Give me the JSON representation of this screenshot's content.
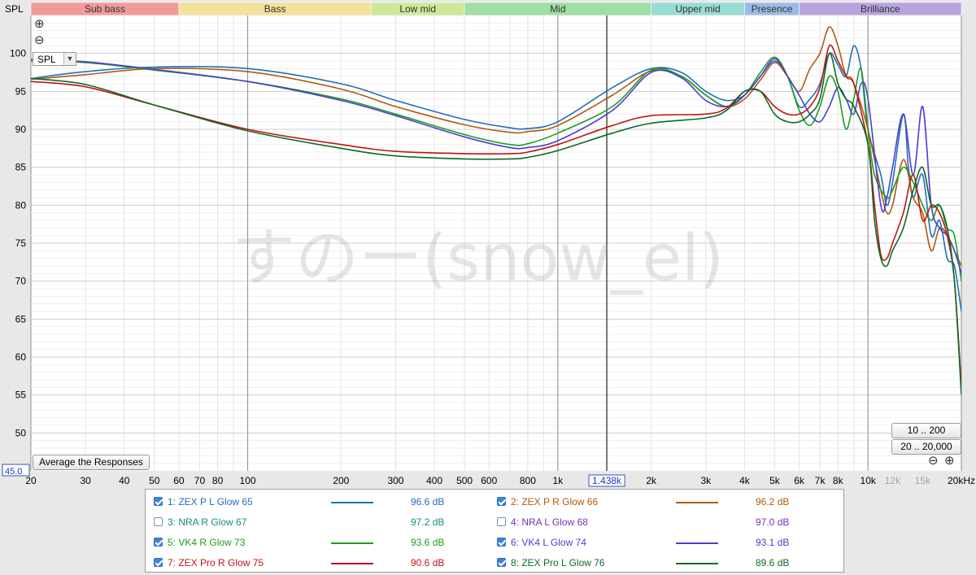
{
  "colors": {
    "zex_p_l": "#1f6fbf",
    "zex_p_r": "#b35a0a",
    "nra_r": "#1a8a82",
    "nra_l": "#7a2fb8",
    "vk4_r": "#1f9d1f",
    "vk4_l": "#4b3fd0",
    "zex_pro_r": "#c01414",
    "zex_pro_l": "#0a6a2a"
  },
  "chart_data": {
    "type": "line",
    "ylabel": "SPL",
    "xunit": "Hz",
    "xscale": "log",
    "xlim": [
      20,
      20000
    ],
    "ylim": [
      45,
      105
    ],
    "yticks": [
      50,
      55,
      60,
      65,
      70,
      75,
      80,
      85,
      90,
      95,
      100
    ],
    "xticks": [
      {
        "v": 20,
        "t": "20"
      },
      {
        "v": 30,
        "t": "30"
      },
      {
        "v": 40,
        "t": "40"
      },
      {
        "v": 50,
        "t": "50"
      },
      {
        "v": 60,
        "t": "60"
      },
      {
        "v": 70,
        "t": "70"
      },
      {
        "v": 80,
        "t": "80"
      },
      {
        "v": 100,
        "t": "100"
      },
      {
        "v": 200,
        "t": "200"
      },
      {
        "v": 300,
        "t": "300"
      },
      {
        "v": 400,
        "t": "400"
      },
      {
        "v": 500,
        "t": "500"
      },
      {
        "v": 600,
        "t": "600"
      },
      {
        "v": 800,
        "t": "800"
      },
      {
        "v": 1000,
        "t": "1k"
      },
      {
        "v": 2000,
        "t": "2k"
      },
      {
        "v": 3000,
        "t": "3k"
      },
      {
        "v": 4000,
        "t": "4k"
      },
      {
        "v": 5000,
        "t": "5k"
      },
      {
        "v": 6000,
        "t": "6k"
      },
      {
        "v": 7000,
        "t": "7k"
      },
      {
        "v": 8000,
        "t": "8k"
      },
      {
        "v": 10000,
        "t": "10k"
      },
      {
        "v": 12000,
        "t": "12k",
        "grey": true
      },
      {
        "v": 15000,
        "t": "15k",
        "grey": true
      },
      {
        "v": 20000,
        "t": "20kHz"
      }
    ],
    "ymin_label": "45.0",
    "cursor": {
      "x": 1438,
      "label": "1.438k"
    },
    "bands": [
      {
        "name": "Sub bass",
        "from": 20,
        "to": 60,
        "color": "#f29a9a"
      },
      {
        "name": "Bass",
        "from": 60,
        "to": 250,
        "color": "#f3e29a"
      },
      {
        "name": "Low mid",
        "from": 250,
        "to": 500,
        "color": "#cfe79a"
      },
      {
        "name": "Mid",
        "from": 500,
        "to": 2000,
        "color": "#9fdea4"
      },
      {
        "name": "Upper mid",
        "from": 2000,
        "to": 4000,
        "color": "#99dcd4"
      },
      {
        "name": "Presence",
        "from": 4000,
        "to": 6000,
        "color": "#9bbbe6"
      },
      {
        "name": "Brilliance",
        "from": 6000,
        "to": 20000,
        "color": "#b8a4dc"
      }
    ],
    "series": [
      {
        "key": "zex_p_l",
        "name": "1: ZEX P L Glow 65",
        "value": "96.6 dB",
        "checked": true,
        "points": [
          [
            20,
            96.7
          ],
          [
            30,
            97.6
          ],
          [
            50,
            98.2
          ],
          [
            100,
            98.0
          ],
          [
            200,
            96.0
          ],
          [
            300,
            93.8
          ],
          [
            500,
            91.3
          ],
          [
            700,
            90.2
          ],
          [
            800,
            90.1
          ],
          [
            1000,
            91.0
          ],
          [
            1500,
            95.5
          ],
          [
            2000,
            98.0
          ],
          [
            2500,
            97.5
          ],
          [
            3000,
            95.0
          ],
          [
            3500,
            93.8
          ],
          [
            4000,
            94.5
          ],
          [
            4500,
            97.0
          ],
          [
            5000,
            99.0
          ],
          [
            5500,
            97.0
          ],
          [
            6000,
            93.0
          ],
          [
            6500,
            94.0
          ],
          [
            7000,
            96.0
          ],
          [
            7500,
            100.0
          ],
          [
            8000,
            98.5
          ],
          [
            8500,
            97.0
          ],
          [
            9000,
            101.0
          ],
          [
            9500,
            98.0
          ],
          [
            10000,
            90.0
          ],
          [
            11000,
            84.0
          ],
          [
            11500,
            80.0
          ],
          [
            12000,
            83.0
          ],
          [
            13000,
            92.0
          ],
          [
            13500,
            85.0
          ],
          [
            14000,
            81.0
          ],
          [
            15000,
            84.0
          ],
          [
            16000,
            76.0
          ],
          [
            17000,
            78.0
          ],
          [
            18000,
            73.0
          ],
          [
            19000,
            72.0
          ],
          [
            20000,
            66.0
          ]
        ]
      },
      {
        "key": "zex_p_r",
        "name": "2: ZEX P R Glow 66",
        "value": "96.2 dB",
        "checked": true,
        "points": [
          [
            20,
            96.6
          ],
          [
            30,
            97.2
          ],
          [
            50,
            98.0
          ],
          [
            100,
            97.6
          ],
          [
            200,
            95.3
          ],
          [
            300,
            93.0
          ],
          [
            500,
            90.6
          ],
          [
            700,
            89.6
          ],
          [
            800,
            89.7
          ],
          [
            1000,
            90.5
          ],
          [
            1500,
            94.5
          ],
          [
            2000,
            97.7
          ],
          [
            2500,
            97.0
          ],
          [
            3000,
            94.5
          ],
          [
            3500,
            93.0
          ],
          [
            4000,
            94.0
          ],
          [
            4500,
            96.5
          ],
          [
            5000,
            98.8
          ],
          [
            5500,
            97.0
          ],
          [
            6000,
            95.0
          ],
          [
            6500,
            98.0
          ],
          [
            7000,
            100.0
          ],
          [
            7500,
            103.5
          ],
          [
            8000,
            101.0
          ],
          [
            8500,
            97.0
          ],
          [
            9000,
            96.0
          ],
          [
            10000,
            90.0
          ],
          [
            11000,
            82.0
          ],
          [
            11500,
            79.0
          ],
          [
            12000,
            80.0
          ],
          [
            13000,
            86.0
          ],
          [
            14000,
            81.0
          ],
          [
            15000,
            79.0
          ],
          [
            16000,
            74.0
          ],
          [
            17000,
            77.0
          ],
          [
            18000,
            76.0
          ],
          [
            19000,
            74.0
          ],
          [
            20000,
            72.0
          ]
        ]
      },
      {
        "key": "nra_r",
        "name": "3: NRA R Glow 67",
        "value": "97.2 dB",
        "checked": false,
        "points": []
      },
      {
        "key": "nra_l",
        "name": "4: NRA L Glow 68",
        "value": "97.0 dB",
        "checked": false,
        "points": []
      },
      {
        "key": "vk4_r",
        "name": "5: VK4 R Glow 73",
        "value": "93.6 dB",
        "checked": true,
        "points": [
          [
            20,
            99.0
          ],
          [
            30,
            98.8
          ],
          [
            50,
            97.8
          ],
          [
            100,
            96.3
          ],
          [
            200,
            94.0
          ],
          [
            300,
            92.0
          ],
          [
            500,
            89.3
          ],
          [
            700,
            88.0
          ],
          [
            800,
            88.1
          ],
          [
            1000,
            89.5
          ],
          [
            1500,
            93.0
          ],
          [
            2000,
            97.8
          ],
          [
            2500,
            97.0
          ],
          [
            3000,
            94.5
          ],
          [
            3500,
            93.0
          ],
          [
            4000,
            94.5
          ],
          [
            4500,
            97.5
          ],
          [
            5000,
            99.5
          ],
          [
            5500,
            97.0
          ],
          [
            6000,
            92.5
          ],
          [
            6500,
            90.5
          ],
          [
            7000,
            93.0
          ],
          [
            7500,
            97.0
          ],
          [
            8000,
            95.0
          ],
          [
            8500,
            90.0
          ],
          [
            9000,
            94.0
          ],
          [
            9500,
            98.0
          ],
          [
            10000,
            90.0
          ],
          [
            10500,
            84.0
          ],
          [
            11500,
            81.0
          ],
          [
            12000,
            82.0
          ],
          [
            13000,
            85.0
          ],
          [
            14000,
            83.0
          ],
          [
            15000,
            80.0
          ],
          [
            16000,
            78.0
          ],
          [
            17000,
            80.0
          ],
          [
            18000,
            77.0
          ],
          [
            19000,
            76.0
          ],
          [
            20000,
            70.0
          ]
        ]
      },
      {
        "key": "vk4_l",
        "name": "6: VK4 L Glow 74",
        "value": "93.1 dB",
        "checked": true,
        "points": [
          [
            20,
            99.2
          ],
          [
            30,
            98.9
          ],
          [
            50,
            97.9
          ],
          [
            100,
            96.3
          ],
          [
            200,
            93.8
          ],
          [
            300,
            91.8
          ],
          [
            500,
            89.0
          ],
          [
            700,
            87.6
          ],
          [
            800,
            87.6
          ],
          [
            1000,
            88.5
          ],
          [
            1500,
            92.5
          ],
          [
            2000,
            97.5
          ],
          [
            2500,
            96.8
          ],
          [
            3000,
            93.8
          ],
          [
            3500,
            93.0
          ],
          [
            4000,
            94.5
          ],
          [
            4500,
            97.0
          ],
          [
            5000,
            99.3
          ],
          [
            5500,
            97.0
          ],
          [
            6000,
            94.5
          ],
          [
            6500,
            92.0
          ],
          [
            7000,
            91.0
          ],
          [
            7500,
            93.0
          ],
          [
            8000,
            95.5
          ],
          [
            8500,
            94.0
          ],
          [
            9000,
            92.0
          ],
          [
            9500,
            96.0
          ],
          [
            10000,
            94.0
          ],
          [
            11000,
            80.0
          ],
          [
            11500,
            81.0
          ],
          [
            12000,
            85.0
          ],
          [
            13000,
            92.0
          ],
          [
            14000,
            84.0
          ],
          [
            15000,
            93.0
          ],
          [
            16000,
            80.0
          ],
          [
            17000,
            77.0
          ],
          [
            18000,
            76.0
          ],
          [
            19000,
            74.0
          ],
          [
            20000,
            71.0
          ]
        ]
      },
      {
        "key": "zex_pro_r",
        "name": "7: ZEX Pro R Glow 75",
        "value": "90.6 dB",
        "checked": true,
        "points": [
          [
            20,
            96.3
          ],
          [
            30,
            95.6
          ],
          [
            50,
            93.2
          ],
          [
            100,
            90.0
          ],
          [
            200,
            88.0
          ],
          [
            300,
            87.1
          ],
          [
            500,
            86.8
          ],
          [
            700,
            86.8
          ],
          [
            800,
            87.0
          ],
          [
            1000,
            88.0
          ],
          [
            1500,
            90.5
          ],
          [
            2000,
            91.8
          ],
          [
            3000,
            92.0
          ],
          [
            3500,
            92.8
          ],
          [
            4000,
            95.0
          ],
          [
            4500,
            95.0
          ],
          [
            5000,
            93.0
          ],
          [
            5500,
            92.0
          ],
          [
            6000,
            92.0
          ],
          [
            6500,
            93.0
          ],
          [
            7000,
            95.5
          ],
          [
            7500,
            101.0
          ],
          [
            8000,
            99.0
          ],
          [
            8500,
            97.0
          ],
          [
            9000,
            96.0
          ],
          [
            10000,
            88.0
          ],
          [
            10500,
            80.0
          ],
          [
            11000,
            73.5
          ],
          [
            11500,
            73.0
          ],
          [
            12000,
            75.0
          ],
          [
            13000,
            79.0
          ],
          [
            14000,
            84.0
          ],
          [
            15000,
            78.0
          ],
          [
            16000,
            80.0
          ],
          [
            17000,
            79.0
          ],
          [
            18000,
            76.0
          ],
          [
            19000,
            70.0
          ],
          [
            20000,
            56.0
          ]
        ]
      },
      {
        "key": "zex_pro_l",
        "name": "8: ZEX Pro L Glow 76",
        "value": "89.6 dB",
        "checked": true,
        "points": [
          [
            20,
            96.7
          ],
          [
            30,
            95.9
          ],
          [
            50,
            93.2
          ],
          [
            100,
            89.8
          ],
          [
            200,
            87.5
          ],
          [
            300,
            86.5
          ],
          [
            500,
            86.1
          ],
          [
            700,
            86.1
          ],
          [
            800,
            86.3
          ],
          [
            1000,
            87.2
          ],
          [
            1500,
            89.5
          ],
          [
            2000,
            90.8
          ],
          [
            3000,
            91.5
          ],
          [
            3500,
            92.5
          ],
          [
            4000,
            95.0
          ],
          [
            4500,
            95.0
          ],
          [
            5000,
            92.0
          ],
          [
            5500,
            91.0
          ],
          [
            6000,
            91.0
          ],
          [
            6500,
            92.0
          ],
          [
            7000,
            94.0
          ],
          [
            7500,
            100.0
          ],
          [
            8000,
            96.0
          ],
          [
            8500,
            94.0
          ],
          [
            9000,
            93.0
          ],
          [
            10000,
            88.0
          ],
          [
            10500,
            78.0
          ],
          [
            11000,
            73.0
          ],
          [
            11500,
            72.0
          ],
          [
            12000,
            74.0
          ],
          [
            13000,
            77.0
          ],
          [
            14000,
            82.0
          ],
          [
            15000,
            85.0
          ],
          [
            16000,
            80.0
          ],
          [
            17000,
            80.0
          ],
          [
            18000,
            77.0
          ],
          [
            19000,
            70.0
          ],
          [
            20000,
            55.0
          ]
        ]
      }
    ]
  },
  "controls": {
    "zoom_in": "⊕",
    "zoom_out": "⊖",
    "spl_select": "SPL",
    "average_button": "Average the Responses",
    "range_button_1": "10 .. 200",
    "range_button_2": "20 .. 20,000"
  },
  "watermark": "すのー(snow_el)"
}
